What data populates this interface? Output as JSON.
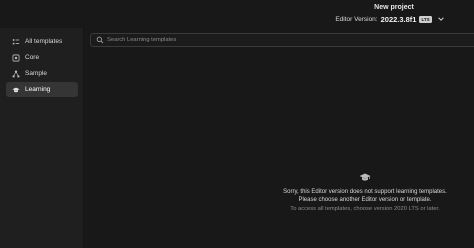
{
  "header": {
    "project_title": "New project",
    "editor_version_label": "Editor Version:",
    "editor_version": "2022.3.8f1",
    "lts_badge": "LTS",
    "chevron_icon": "chevron-down-icon"
  },
  "sidebar": {
    "items": [
      {
        "label": "All templates",
        "icon": "list-icon",
        "active": false
      },
      {
        "label": "Core",
        "icon": "box-icon",
        "active": false
      },
      {
        "label": "Sample",
        "icon": "nodes-icon",
        "active": false
      },
      {
        "label": "Learning",
        "icon": "graduation-cap-icon",
        "active": true
      }
    ]
  },
  "search": {
    "placeholder": "Search Learning templates",
    "value": "",
    "icon": "search-icon"
  },
  "empty_state": {
    "icon": "graduation-cap-icon",
    "message": "Sorry, this Editor version does not support learning templates. Please choose another Editor version or template.",
    "hint": "To access all templates, choose version 2020 LTS or later."
  },
  "colors": {
    "background": "#191919",
    "sidebar": "#1f1f1f",
    "active_item": "#353535",
    "text": "#d9d9d9",
    "muted_text": "#8c8c8c"
  }
}
